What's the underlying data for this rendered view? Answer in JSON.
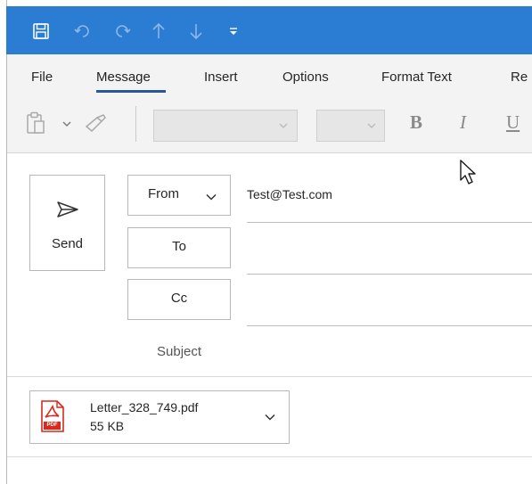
{
  "quick_access": {
    "icons": [
      "save-icon",
      "undo-icon",
      "redo-icon",
      "up-arrow-icon",
      "down-arrow-icon",
      "customize-toolbar-icon"
    ]
  },
  "ribbon": {
    "tabs": [
      {
        "label": "File"
      },
      {
        "label": "Message"
      },
      {
        "label": "Insert"
      },
      {
        "label": "Options"
      },
      {
        "label": "Format Text"
      },
      {
        "label": "Re"
      }
    ],
    "active_tab": "Message",
    "format": {
      "bold": "B",
      "italic": "I",
      "underline": "U"
    }
  },
  "compose": {
    "send_label": "Send",
    "from_label": "From",
    "from_value": "Test@Test.com",
    "to_label": "To",
    "cc_label": "Cc",
    "subject_label": "Subject"
  },
  "attachment": {
    "icon_text": "PDF",
    "filename": "Letter_328_749.pdf",
    "size": "55 KB"
  },
  "colors": {
    "title_bar": "#2b7cd3",
    "ribbon_bg": "#f3f3f3",
    "active_tab_underline": "#2b5797",
    "pdf_red": "#d9291c"
  }
}
